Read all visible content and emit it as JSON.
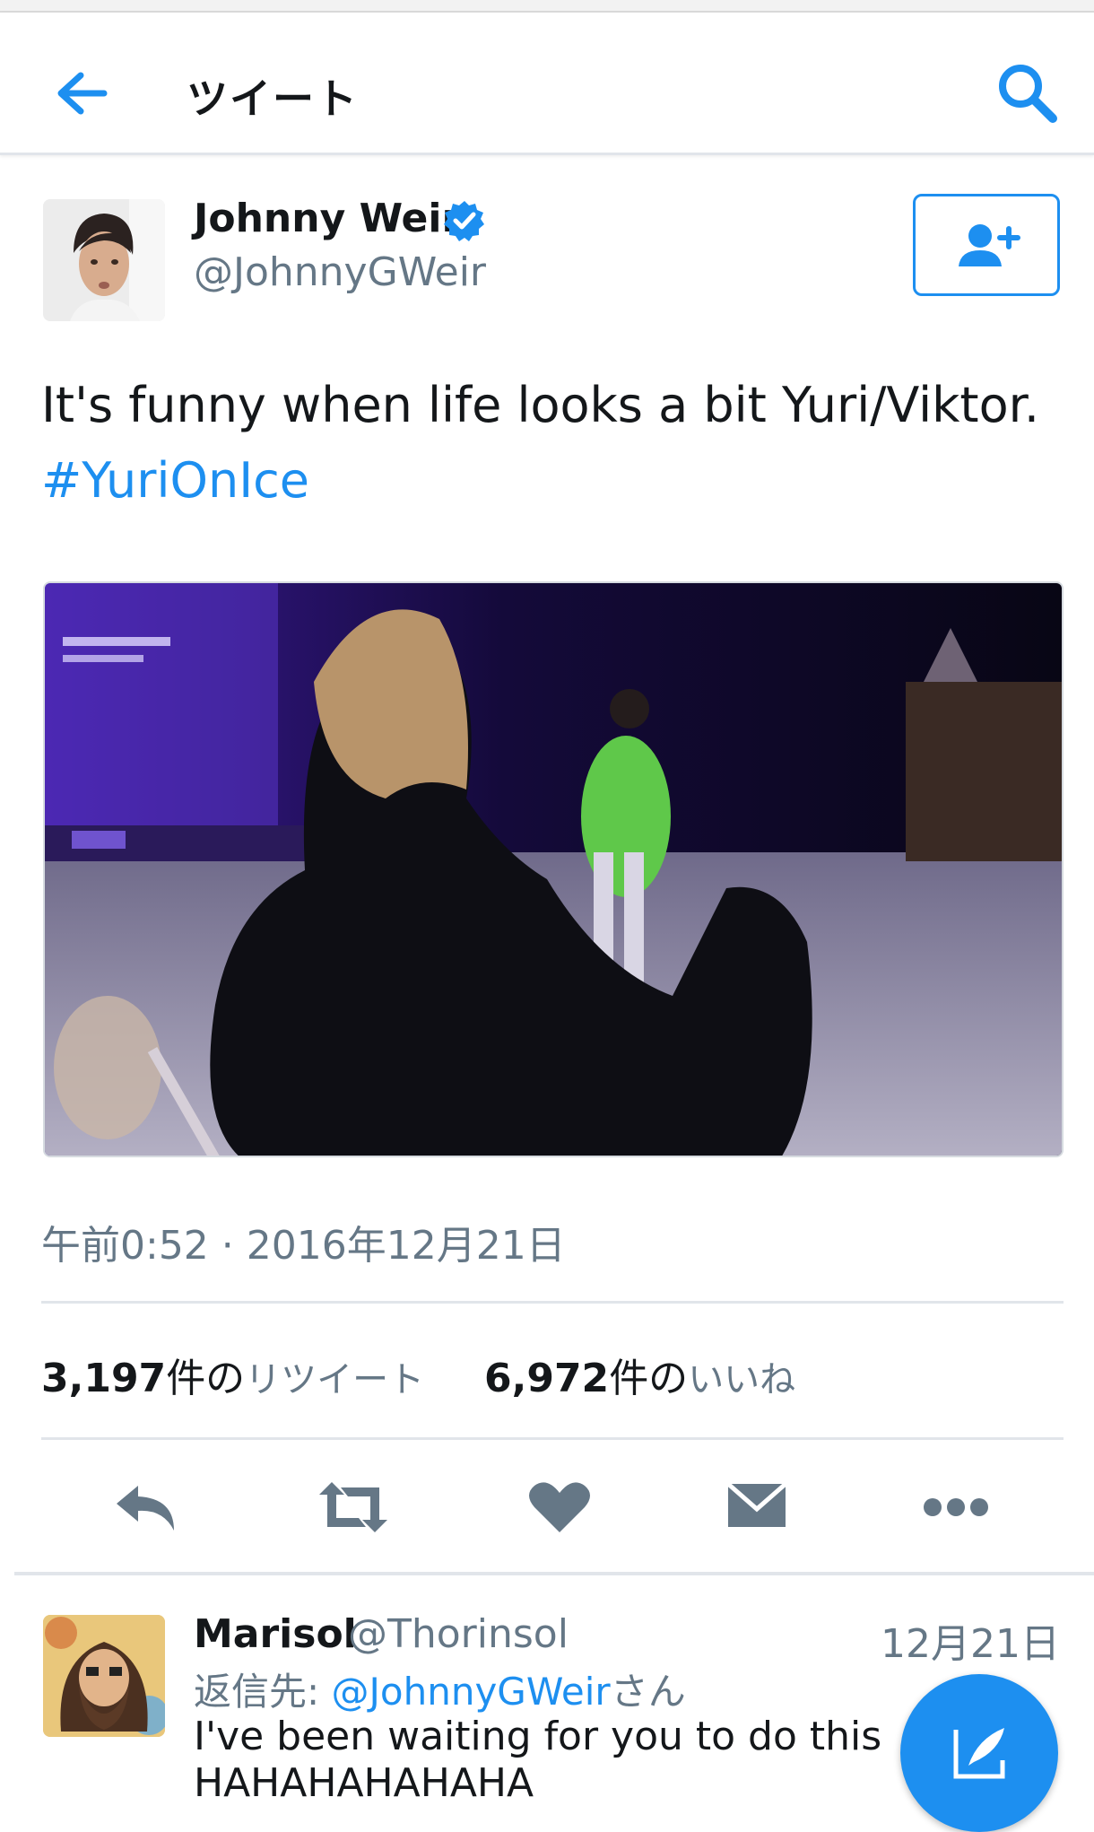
{
  "header": {
    "title": "ツイート",
    "back_icon": "arrow-left-icon",
    "search_icon": "search-icon"
  },
  "tweet": {
    "author_name": "Johnny Weir",
    "author_handle": "@JohnnyGWeir",
    "verified": true,
    "text": "It's funny when life looks a bit Yuri/Viktor.",
    "hashtag": "#YuriOnIce",
    "timestamp": "午前0:52 · 2016年12月21日",
    "retweets_count": "3,197",
    "retweets_unit": "件の",
    "retweets_label": "リツイート",
    "likes_count": "6,972",
    "likes_unit": "件の",
    "likes_label": "いいね",
    "media_description_icon": "video-thumbnail"
  },
  "actions": [
    "reply-icon",
    "retweet-icon",
    "heart-icon",
    "envelope-icon",
    "more-icon"
  ],
  "reply": {
    "author_name": "Marisol",
    "author_handle": "@Thorinsol",
    "date": "12月21日",
    "reply_prefix": "返信先: ",
    "reply_to": "@JohnnyGWeir",
    "reply_suffix": "さん",
    "text_line1": "I've been waiting for you to do this",
    "text_line2": "HAHAHAHAHAHA"
  },
  "colors": {
    "accent": "#1d8ff0",
    "secondary_text": "#657786",
    "divider": "#e1e5ea"
  }
}
